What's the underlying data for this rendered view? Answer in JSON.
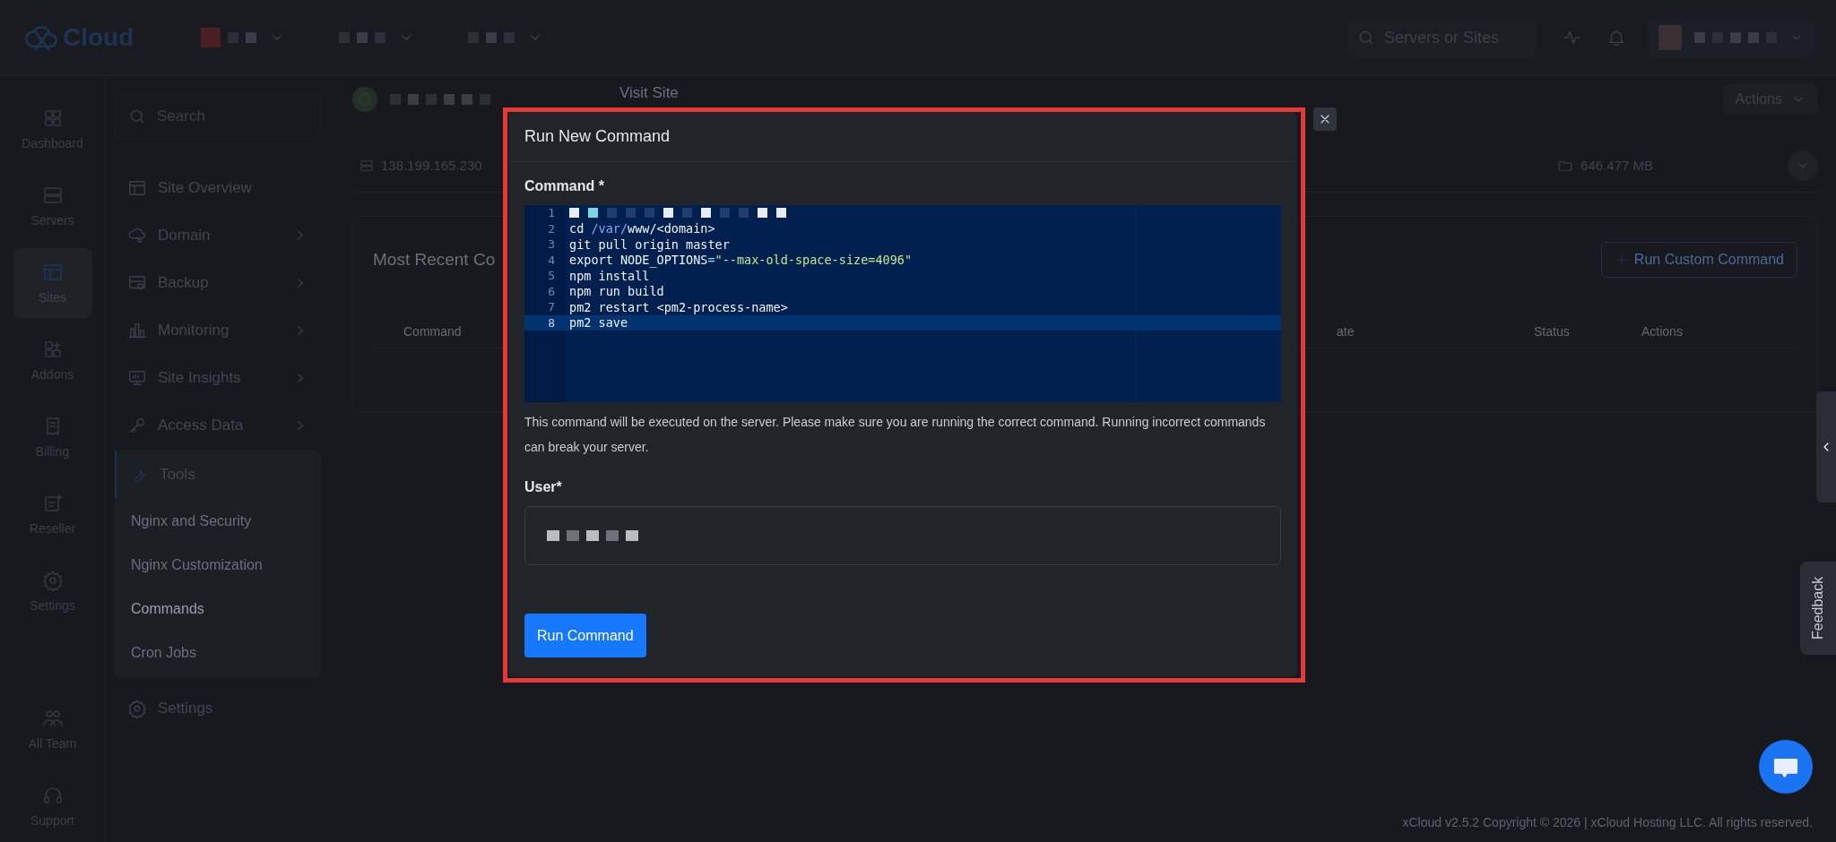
{
  "topbar": {
    "logo": "Cloud",
    "selectors": [
      {
        "redacted": true
      },
      {
        "redacted": true
      },
      {
        "redacted": true
      }
    ],
    "search": {
      "placeholder": "Servers or Sites"
    }
  },
  "rail": {
    "main": [
      {
        "label": "Dashboard",
        "selected": false
      },
      {
        "label": "Servers",
        "selected": false
      },
      {
        "label": "Sites",
        "selected": true
      },
      {
        "label": "Addons",
        "selected": false
      },
      {
        "label": "Billing",
        "selected": false
      },
      {
        "label": "Reseller",
        "selected": false
      },
      {
        "label": "Settings",
        "selected": false
      }
    ],
    "bottom": [
      {
        "label": "All Team",
        "selected": false
      },
      {
        "label": "Support",
        "selected": false
      }
    ]
  },
  "site_menu": {
    "search": {
      "placeholder": "Search"
    },
    "items": [
      {
        "label": "Site Overview",
        "has_submenu": false
      },
      {
        "label": "Domain",
        "has_submenu": true
      },
      {
        "label": "Backup",
        "has_submenu": true
      },
      {
        "label": "Monitoring",
        "has_submenu": true
      },
      {
        "label": "Site Insights",
        "has_submenu": true
      },
      {
        "label": "Access Data",
        "has_submenu": true
      },
      {
        "label": "Tools",
        "has_submenu": false,
        "expanded": true,
        "children": [
          {
            "label": "Nginx and Security",
            "selected": false
          },
          {
            "label": "Nginx Customization",
            "selected": false
          },
          {
            "label": "Commands",
            "selected": true
          },
          {
            "label": "Cron Jobs",
            "selected": false
          }
        ]
      },
      {
        "label": "Settings",
        "has_submenu": false
      }
    ]
  },
  "site_header": {
    "link": "Visit Site",
    "actions": "Actions"
  },
  "stats": [
    "138.199.165.230",
    "646.477 MB"
  ],
  "commands_card": {
    "title": "Most Recent Co",
    "button": "Run Custom Command",
    "columns": [
      "Command",
      "ate",
      "Status",
      "Actions"
    ]
  },
  "modal": {
    "title": "Run New Command",
    "command_label": "Command *",
    "lines": [
      {
        "number": "1",
        "redacted": true,
        "active": false
      },
      {
        "number": "2",
        "redacted": false,
        "active": false,
        "tokens": [
          {
            "text": "cd ",
            "kind": "plain"
          },
          {
            "text": "/var/",
            "kind": "path"
          },
          {
            "text": "www/<domain>",
            "kind": "plain"
          }
        ]
      },
      {
        "number": "3",
        "redacted": false,
        "active": false,
        "tokens": [
          {
            "text": "git pull origin master",
            "kind": "plain"
          }
        ]
      },
      {
        "number": "4",
        "redacted": false,
        "active": false,
        "tokens": [
          {
            "text": "export NODE_OPTIONS",
            "kind": "plain"
          },
          {
            "text": "=",
            "kind": "operator"
          },
          {
            "text": "\"--max-old-space-size=4096\"",
            "kind": "string"
          }
        ]
      },
      {
        "number": "5",
        "redacted": false,
        "active": false,
        "tokens": [
          {
            "text": "npm install",
            "kind": "plain"
          }
        ]
      },
      {
        "number": "6",
        "redacted": false,
        "active": false,
        "tokens": [
          {
            "text": "npm run build",
            "kind": "plain"
          }
        ]
      },
      {
        "number": "7",
        "redacted": false,
        "active": false,
        "tokens": [
          {
            "text": "pm2 restart <pm2-process-name>",
            "kind": "plain"
          }
        ]
      },
      {
        "number": "8",
        "redacted": false,
        "active": true,
        "tokens": [
          {
            "text": "pm2 save",
            "kind": "plain"
          }
        ]
      }
    ],
    "note": "This command will be executed on the server. Please make sure you are running the correct command. Running incorrect commands can break your server.",
    "user_label": "User*",
    "user_value_redacted": true,
    "submit": "Run Command"
  },
  "feedback": "Feedback",
  "footer": "xCloud v2.5.2 Copyright © 2026 | xCloud Hosting LLC. All rights reserved."
}
